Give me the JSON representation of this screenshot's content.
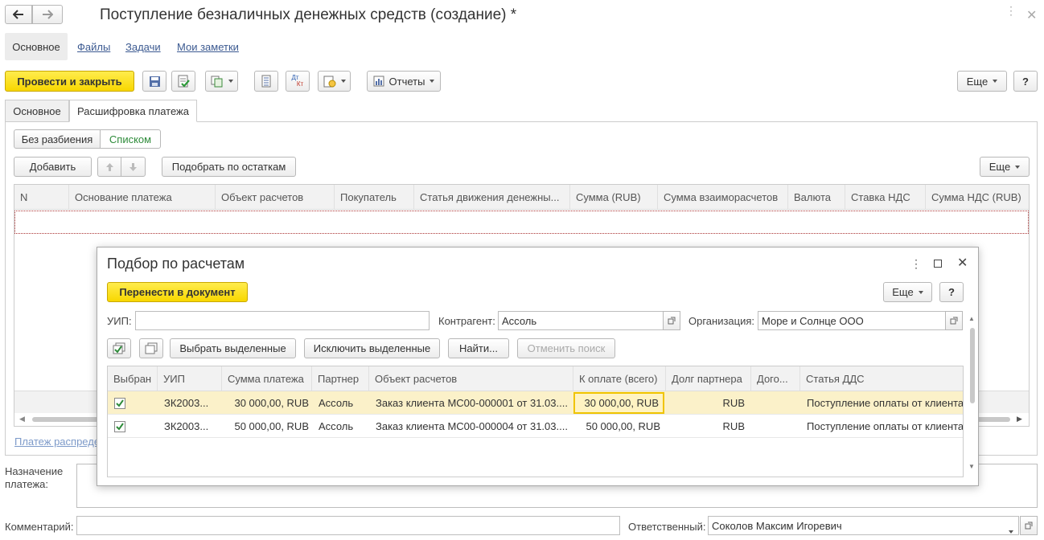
{
  "window": {
    "title": "Поступление безналичных денежных средств (создание) *"
  },
  "nav_tabs": {
    "main": "Основное",
    "files": "Файлы",
    "tasks": "Задачи",
    "notes": "Мои заметки"
  },
  "toolbar": {
    "post_close": "Провести и закрыть",
    "reports": "Отчеты",
    "more": "Еще",
    "help": "?",
    "dtkt_top": "Дт",
    "dtkt_bottom": "Кт"
  },
  "form_tabs": {
    "main": "Основное",
    "payment_breakdown": "Расшифровка платежа"
  },
  "breakdown": {
    "mode_no_split": "Без разбиения",
    "mode_list": "Списком",
    "add": "Добавить",
    "pick_remaining": "Подобрать по остаткам",
    "more": "Еще",
    "columns": [
      "N",
      "Основание платежа",
      "Объект расчетов",
      "Покупатель",
      "Статья движения денежны...",
      "Сумма (RUB)",
      "Сумма взаиморасчетов",
      "Валюта",
      "Ставка НДС",
      "Сумма НДС (RUB)"
    ],
    "footer_link": "Платеж распреде"
  },
  "bottom": {
    "purpose_label_1": "Назначение",
    "purpose_label_2": "платежа:",
    "comment_label": "Комментарий:",
    "responsible_label": "Ответственный:",
    "responsible_value": "Соколов Максим Игоревич"
  },
  "dialog": {
    "title": "Подбор по расчетам",
    "transfer": "Перенести в документ",
    "more": "Еще",
    "help": "?",
    "uip_label": "УИП:",
    "uip_value": "",
    "counterparty_label": "Контрагент:",
    "counterparty_value": "Ассоль",
    "org_label": "Организация:",
    "org_value": "Море и Солнце ООО",
    "select_selected": "Выбрать выделенные",
    "exclude_selected": "Исключить выделенные",
    "find": "Найти...",
    "cancel_search": "Отменить поиск",
    "columns": [
      "Выбран",
      "УИП",
      "Сумма платежа",
      "Партнер",
      "Объект расчетов",
      "К оплате (всего)",
      "Долг партнера",
      "Дого...",
      "Статья ДДС"
    ],
    "rows": [
      {
        "uip": "ЗК2003...",
        "amount": "30 000,00, RUB",
        "partner": "Ассоль",
        "object": "Заказ клиента МС00-000001 от 31.03....",
        "to_pay": "30 000,00, RUB",
        "debt": "RUB",
        "contract": "",
        "article": "Поступление оплаты от клиента"
      },
      {
        "uip": "ЗК2003...",
        "amount": "50 000,00, RUB",
        "partner": "Ассоль",
        "object": "Заказ клиента МС00-000004 от 31.03....",
        "to_pay": "50 000,00, RUB",
        "debt": "RUB",
        "contract": "",
        "article": "Поступление оплаты от клиента"
      }
    ]
  },
  "colors": {
    "accent_yellow": "#f8d700",
    "link": "#3c5a91",
    "selected_row": "#fbf1c9",
    "check_green": "#2e8b3a",
    "list_green": "#2e8b3a"
  }
}
